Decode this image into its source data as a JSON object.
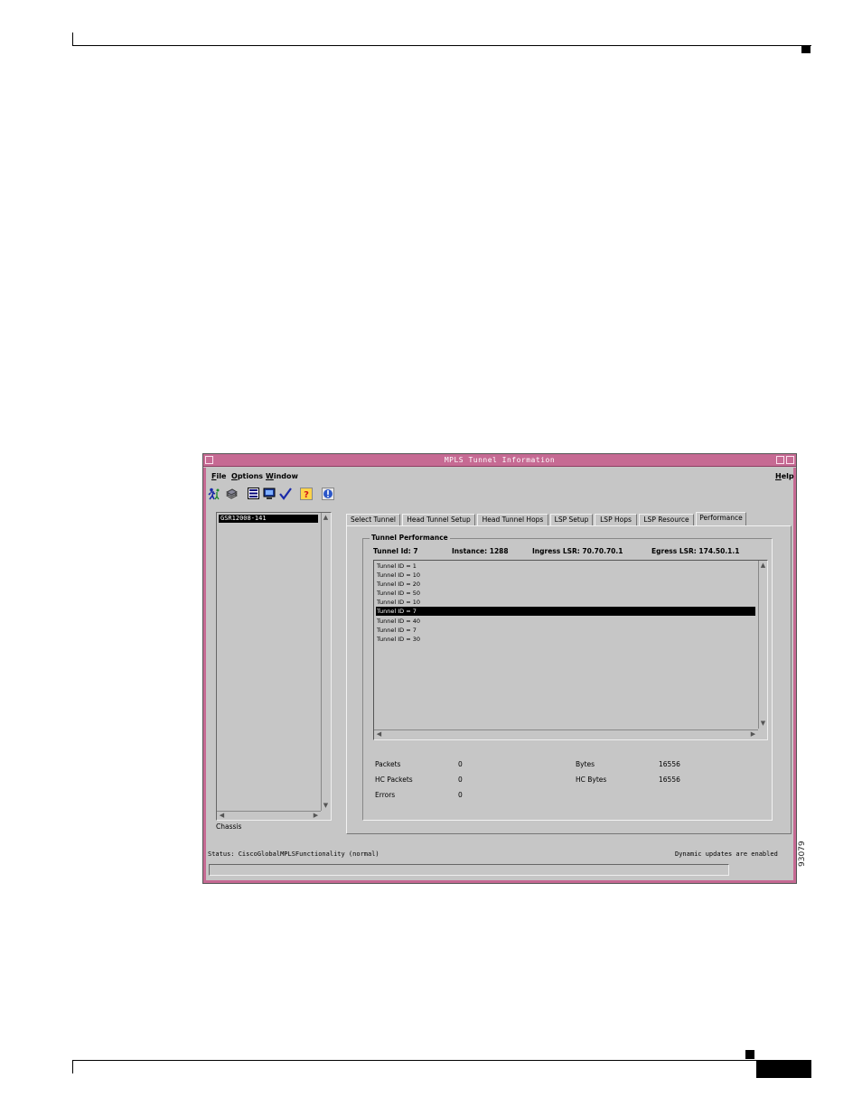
{
  "figure_number": "93079",
  "window": {
    "title": "MPLS Tunnel Information",
    "menus": [
      "File",
      "Options",
      "Window"
    ],
    "help_menu": "Help",
    "toolbar_icons": [
      "run-icon",
      "stack-icon",
      "list-icon",
      "monitor-icon",
      "check-icon",
      "help-icon",
      "info-icon"
    ]
  },
  "tree": {
    "selected_item": "GSR12008-141",
    "label": "Chassis"
  },
  "tabs": [
    "Select Tunnel",
    "Head Tunnel Setup",
    "Head Tunnel Hops",
    "LSP Setup",
    "LSP Hops",
    "LSP Resource",
    "Performance"
  ],
  "active_tab": "Performance",
  "panel": {
    "group_title": "Tunnel Performance",
    "tunnel_id": "Tunnel Id:  7",
    "instance": "Instance:  1288",
    "ingress": "Ingress LSR:  70.70.70.1",
    "egress": "Egress LSR:  174.50.1.1",
    "tunnels": [
      "Tunnel ID = 1",
      "Tunnel ID = 10",
      "Tunnel ID = 20",
      "Tunnel ID = 50",
      "Tunnel ID = 10",
      "Tunnel ID = 7",
      "Tunnel ID = 40",
      "Tunnel ID = 7",
      "Tunnel ID = 30"
    ],
    "selected_index": 5,
    "stats": {
      "packets_label": "Packets",
      "packets": "0",
      "hc_packets_label": "HC Packets",
      "hc_packets": "0",
      "errors_label": "Errors",
      "errors": "0",
      "bytes_label": "Bytes",
      "bytes": "16556",
      "hc_bytes_label": "HC Bytes",
      "hc_bytes": "16556"
    }
  },
  "status": {
    "left": "Status: CiscoGlobalMPLSFunctionality (normal)",
    "right": "Dynamic updates are enabled"
  }
}
